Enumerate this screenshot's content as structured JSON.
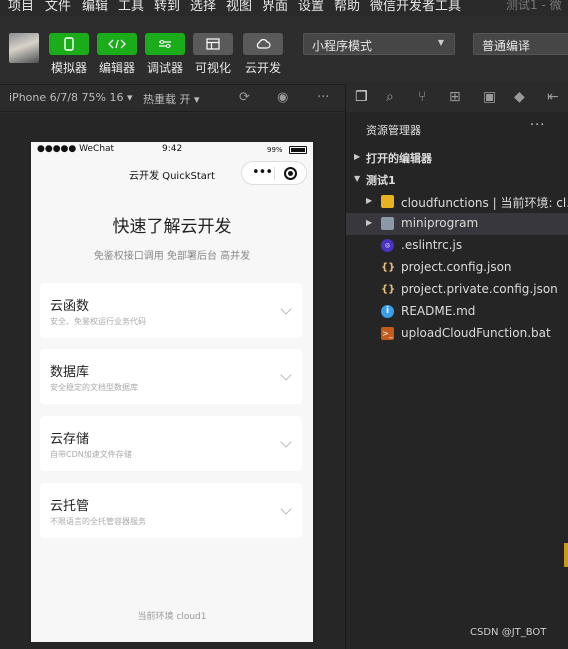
{
  "menubar": {
    "items": [
      "项目",
      "文件",
      "编辑",
      "工具",
      "转到",
      "选择",
      "视图",
      "界面",
      "设置",
      "帮助",
      "微信开发者工具"
    ],
    "window_title": "测试1 - 微"
  },
  "toolbar": {
    "buttons": [
      {
        "label": "模拟器",
        "icon": "phone-icon"
      },
      {
        "label": "编辑器",
        "icon": "code-icon"
      },
      {
        "label": "调试器",
        "icon": "sliders-icon"
      },
      {
        "label": "可视化",
        "icon": "layout-icon"
      },
      {
        "label": "云开发",
        "icon": "cloud-icon"
      }
    ],
    "mode_select": "小程序模式",
    "compile_select": "普通编译"
  },
  "simbar": {
    "device": "iPhone 6/7/8 75% 16 ▾",
    "hot_reload": "热重载 开 ▾",
    "more": "···"
  },
  "phone": {
    "status_left": "●●●●● WeChat",
    "time": "9:42",
    "battery": "99%",
    "nav_title": "云开发 QuickStart",
    "hero_title": "快速了解云开发",
    "hero_sub": "免鉴权接口调用 免部署后台 高并发",
    "cards": [
      {
        "title": "云函数",
        "desc": "安全、免鉴权运行业务代码"
      },
      {
        "title": "数据库",
        "desc": "安全稳定的文档型数据库"
      },
      {
        "title": "云存储",
        "desc": "自带CDN加速文件存储"
      },
      {
        "title": "云托管",
        "desc": "不限语言的全托管容器服务"
      }
    ],
    "env": "当前环境 cloud1"
  },
  "explorer": {
    "title": "资源管理器",
    "more": "···",
    "open_editors": "打开的编辑器",
    "project": "测试1",
    "items": [
      {
        "label": "cloudfunctions | 当前环境: cl...",
        "icon": "folder-icon"
      },
      {
        "label": "miniprogram",
        "icon": "folder-icon"
      },
      {
        "label": ".eslintrc.js",
        "icon": "eslint-icon"
      },
      {
        "label": "project.config.json",
        "icon": "json-icon"
      },
      {
        "label": "project.private.config.json",
        "icon": "json-icon"
      },
      {
        "label": "README.md",
        "icon": "info-icon"
      },
      {
        "label": "uploadCloudFunction.bat",
        "icon": "terminal-icon"
      }
    ]
  },
  "watermark": "CSDN @JT_BOT",
  "colors": {
    "accent": "#1aad19",
    "background": "#2b2b2b",
    "explorer": "#252526"
  }
}
